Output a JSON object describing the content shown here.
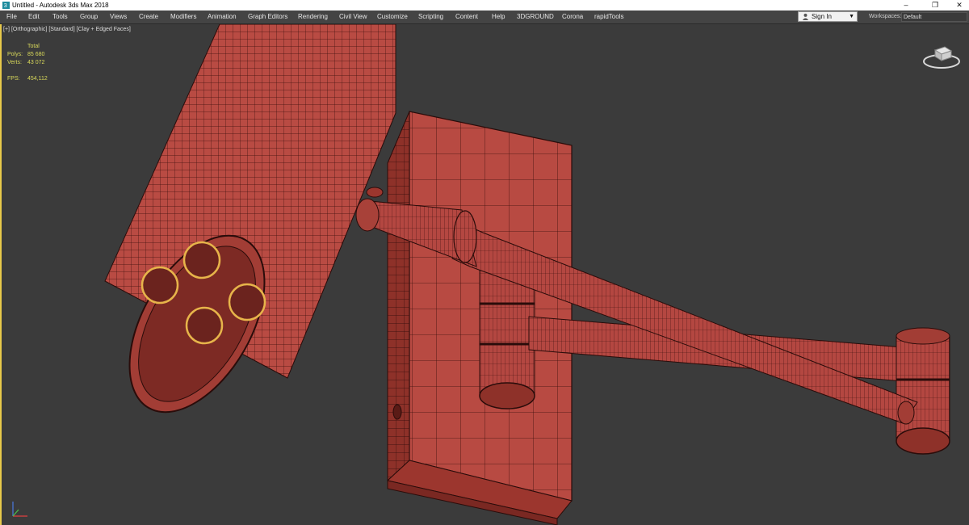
{
  "window": {
    "title": "Untitled - Autodesk 3ds Max 2018",
    "controls": {
      "minimize": "–",
      "maximize": "❐",
      "close": "✕"
    }
  },
  "menu": {
    "items": [
      "File",
      "Edit",
      "Tools",
      "Group",
      "Views",
      "Create",
      "Modifiers",
      "Animation",
      "Graph Editors",
      "Rendering",
      "Civil View",
      "Customize",
      "Scripting",
      "Content",
      "Help",
      "3DGROUND",
      "Corona",
      "rapidTools"
    ]
  },
  "account": {
    "sign_in_label": "Sign In"
  },
  "workspaces": {
    "label": "Workspaces:",
    "value": "Default"
  },
  "viewport": {
    "labels": [
      "[+]",
      "[Orthographic]",
      "[Standard]",
      "[Clay + Edged Faces]"
    ],
    "stats": {
      "header": "Total",
      "polys_label": "Polys:",
      "polys_value": "85 680",
      "verts_label": "Verts:",
      "verts_value": "43 072",
      "fps_label": "FPS:",
      "fps_value": "454,112"
    },
    "colors": {
      "clay": "#b94b43",
      "wire": "#2a0c0a",
      "bulb": "#e7b44a",
      "active_border": "#e8c94a"
    }
  }
}
